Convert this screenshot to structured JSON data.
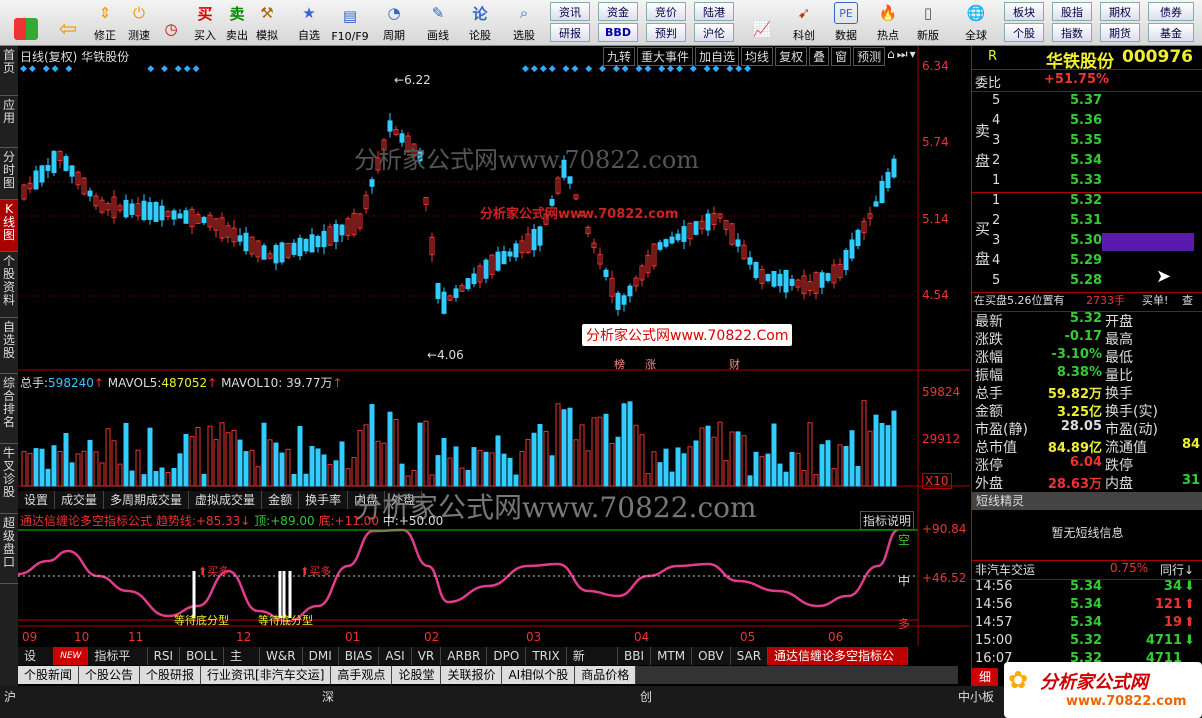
{
  "toolbar": {
    "items": [
      "",
      "",
      "修正",
      "测速",
      "买入",
      "卖出",
      "模拟",
      "自选",
      "F10/F9",
      "周期",
      "画线",
      "论股",
      "选股",
      "",
      "",
      "",
      "",
      "科创",
      "龙虎",
      "数据",
      "热点",
      "新版",
      "全球",
      "",
      "",
      "",
      ""
    ],
    "buttons": [
      "资讯",
      "资金",
      "竞价",
      "陆港",
      "研报",
      "BBD",
      "预判",
      "沪伦",
      "板块",
      "股指",
      "期权",
      "债券",
      "个股",
      "指数",
      "期货",
      "基金"
    ]
  },
  "leftnav": [
    "首页",
    "应用",
    "分时图",
    "K线图",
    "个股资料",
    "自选股",
    "综合排名",
    "牛叉诊股",
    "超级盘口"
  ],
  "chart": {
    "header": "日线(复权)  华铁股份",
    "top_buttons": [
      "九转",
      "重大事件",
      "加自选",
      "均线",
      "复权",
      "叠",
      "窗",
      "预测"
    ],
    "price_labels": [
      "6.34",
      "5.74",
      "5.14",
      "4.54"
    ],
    "high_label": "6.22",
    "low_label": "4.06",
    "watermark1": "分析家公式网www.70822.com",
    "watermark_red": "分析家公式网www.70822.com",
    "watermark_box": "分析家公式网www.70822.Com",
    "event_marks": [
      "榜",
      "涨",
      "财"
    ],
    "vol_header": {
      "total_label": "总手:",
      "total": "598240",
      "ma5_label": "MAVOL5:",
      "ma5": "487052",
      "ma10_label": "MAVOL10:",
      "ma10": "39.77万"
    },
    "vol_labels": [
      "59824",
      "29912",
      "X10"
    ],
    "vol_tabs": [
      "设置",
      "成交量",
      "多周期成交量",
      "虚拟成交量",
      "金额",
      "换手率",
      "内盘",
      "外盘"
    ],
    "ind_header": {
      "name": "通达信缠论多空指标公式",
      "trend_label": "趋势线:",
      "trend": "+85.33",
      "top_label": "顶:",
      "top": "+89.00",
      "bottom_label": "底:",
      "bottom": "+11.00",
      "mid_label": "中:",
      "mid": "+50.00",
      "explain": "指标说明"
    },
    "ind_labels": [
      "+90.84",
      "+46.52"
    ],
    "ind_marks": [
      "空",
      "中",
      "多"
    ],
    "ind_texts": [
      "买多",
      "买多",
      "等待底分型",
      "等待底分型"
    ],
    "months": [
      "09",
      "10",
      "11",
      "12",
      "01",
      "02",
      "03",
      "04",
      "05",
      "06"
    ],
    "ind_tabs": [
      "设置",
      "NEW",
      "指标平台",
      "RSI",
      "BOLL",
      "主力",
      "W&R",
      "DMI",
      "BIAS",
      "ASI",
      "VR",
      "ARBR",
      "DPO",
      "TRIX",
      "新DMA",
      "BBI",
      "MTM",
      "OBV",
      "SAR",
      "通达信缠论多空指标公式"
    ],
    "news_tabs": [
      "个股新闻",
      "个股公告",
      "个股研报",
      "行业资讯[非汽车交运]",
      "高手观点",
      "论股堂",
      "关联报价",
      "AI相似个股",
      "商品价格"
    ]
  },
  "right": {
    "code_prefix": "R",
    "name": "华铁股份",
    "code": "000976",
    "weibi_label": "委比",
    "weibi": "+51.75%",
    "sell_label": "卖盘",
    "buy_label": "买盘",
    "sells": [
      {
        "n": "5",
        "p": "5.37"
      },
      {
        "n": "4",
        "p": "5.36"
      },
      {
        "n": "3",
        "p": "5.35"
      },
      {
        "n": "2",
        "p": "5.34"
      },
      {
        "n": "1",
        "p": "5.33"
      }
    ],
    "buys": [
      {
        "n": "1",
        "p": "5.32"
      },
      {
        "n": "2",
        "p": "5.31"
      },
      {
        "n": "3",
        "p": "5.30"
      },
      {
        "n": "4",
        "p": "5.29"
      },
      {
        "n": "5",
        "p": "5.28"
      }
    ],
    "info_line": "在买盘5.26位置有",
    "info_vol": "2733手",
    "info_tail": "买单!",
    "info_btn": "查",
    "stats_left": [
      [
        "最新",
        "5.32"
      ],
      [
        "涨跌",
        "-0.17"
      ],
      [
        "涨幅",
        "-3.10%"
      ],
      [
        "振幅",
        "8.38%"
      ],
      [
        "总手",
        "59.82万"
      ],
      [
        "金额",
        "3.25亿"
      ],
      [
        "市盈(静)",
        "28.05"
      ],
      [
        "总市值",
        "84.89亿"
      ],
      [
        "涨停",
        "6.04"
      ],
      [
        "外盘",
        "28.63万"
      ]
    ],
    "stats_right": [
      [
        "开盘",
        ""
      ],
      [
        "最高",
        ""
      ],
      [
        "最低",
        ""
      ],
      [
        "量比",
        ""
      ],
      [
        "换手",
        ""
      ],
      [
        "换手(实)",
        ""
      ],
      [
        "市盈(动)",
        ""
      ],
      [
        "流通值",
        "84"
      ],
      [
        "跌停",
        ""
      ],
      [
        "内盘",
        "31"
      ]
    ],
    "short_title": "短线精灵",
    "short_msg": "暂无短线信息",
    "sector": "非汽车交运",
    "sector_pct": "0.75%",
    "sector_tail": "同行↓",
    "ticks": [
      [
        "14:56",
        "5.34",
        "34"
      ],
      [
        "14:56",
        "5.34",
        "121"
      ],
      [
        "14:57",
        "5.34",
        "19"
      ],
      [
        "15:00",
        "5.32",
        "4711"
      ],
      [
        "16:07",
        "5.32",
        "4711"
      ]
    ],
    "tab_small": "细"
  },
  "status": {
    "a": "沪",
    "b": "深",
    "c": "创",
    "d": "中小板"
  },
  "logo": {
    "text": "分析家公式网",
    "url": "www.70822.com"
  }
}
